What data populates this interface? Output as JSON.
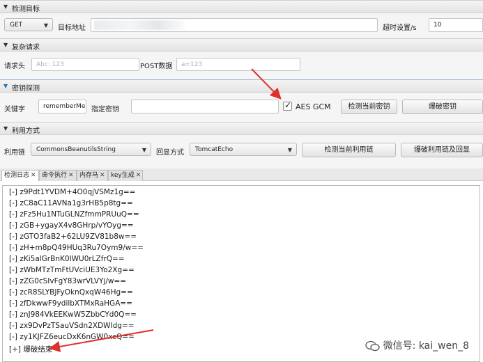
{
  "sections": {
    "target": {
      "title": "检测目标"
    },
    "complex": {
      "title": "复杂请求"
    },
    "key": {
      "title": "密钥探测"
    },
    "exploit": {
      "title": "利用方式"
    }
  },
  "target_row": {
    "method": "GET",
    "url_label": "目标地址",
    "url_value": "",
    "timeout_label": "超时设置/s",
    "timeout_value": "10"
  },
  "complex_row": {
    "headers_label": "请求头",
    "headers_placeholder": "Abc: 123",
    "post_label": "POST数据",
    "post_placeholder": "a=123"
  },
  "key_row": {
    "keyword_label": "关键字",
    "keyword_value": "rememberMe",
    "specify_key_label": "指定密钥",
    "specify_key_value": "",
    "aes_gcm_label": "AES GCM",
    "aes_gcm_checked": true,
    "detect_key_button": "检测当前密钥",
    "brute_key_button": "爆破密钥"
  },
  "exploit_row": {
    "chain_label": "利用链",
    "chain_value": "CommonsBeanutilsString",
    "echo_label": "回显方式",
    "echo_value": "TomcatEcho",
    "detect_chain_button": "检测当前利用链",
    "brute_chain_button": "爆破利用链及回显"
  },
  "tabs": [
    {
      "label": "检测日志",
      "close": "✕"
    },
    {
      "label": "命令执行",
      "close": "✕"
    },
    {
      "label": "内存马",
      "close": "✕"
    },
    {
      "label": "key生成",
      "close": "✕"
    }
  ],
  "log_lines": [
    "[-] z9Pdt1YVDM+4O0qjVSMz1g==",
    "[-] zC8aC11AVNa1g3rHB5p8tg==",
    "[-] zFz5Hu1NTuGLNZfmmPRUuQ==",
    "[-] zGB+ygayX4v8GHrp/vYOyg==",
    "[-] zGTO3faB2+62LU9ZV81b8w==",
    "[-] zH+m8pQ49HUq3Ru7Oym9/w==",
    "[-] zKi5alGrBnK0IWU0rLZfrQ==",
    "[-] zWbMTzTmFtUVciUE3Yo2Xg==",
    "[-] zZG0cSIvFgY83wrVLVYj/w==",
    "[-] zcR8SLYBJFyOknQxqW46Hg==",
    "[-] zfDkwwF9ydilbXTMxRaHGA==",
    "[-] znJ984VkEEKwW5ZbbCYd0Q==",
    "[-] zx9DvPzTSauVSdn2XDWIdg==",
    "[-] zy1KJFZ6eucDxK6nGW0xcQ==",
    "[+] 爆破结束"
  ],
  "watermark": "微信号: kai_wen_8",
  "colors": {
    "arrow": "#e0302a",
    "accent_blue": "#2a6fb5"
  }
}
